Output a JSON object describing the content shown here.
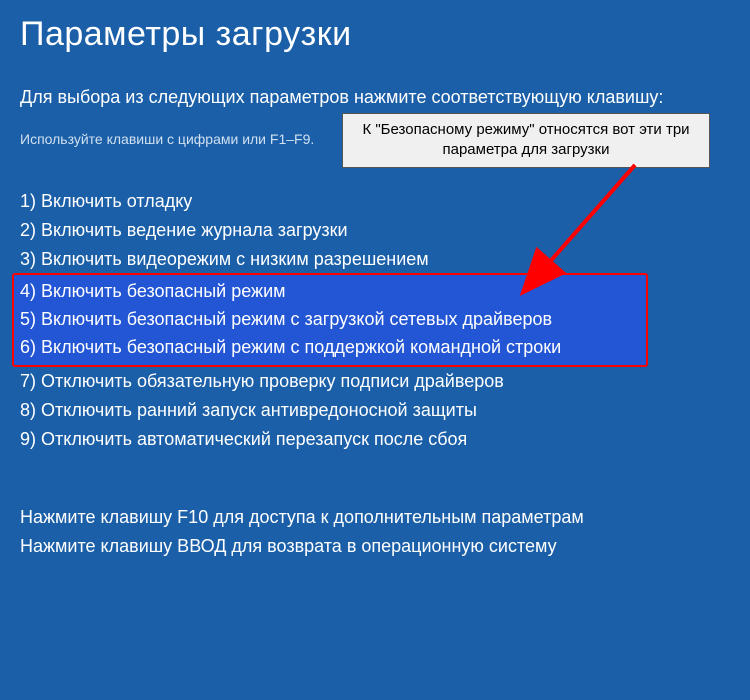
{
  "title": "Параметры загрузки",
  "instruction": "Для выбора из следующих параметров нажмите соответствующую клавишу:",
  "subinstruction": "Используйте клавиши с цифрами или F1–F9.",
  "options": [
    "1) Включить отладку",
    "2) Включить ведение журнала загрузки",
    "3) Включить видеорежим с низким разрешением",
    "4) Включить безопасный режим",
    "5) Включить безопасный режим с загрузкой сетевых драйверов",
    "6) Включить безопасный режим с поддержкой командной строки",
    "7) Отключить обязательную проверку подписи драйверов",
    "8) Отключить ранний запуск антивредоносной защиты",
    "9) Отключить автоматический перезапуск после сбоя"
  ],
  "footer": {
    "f10": "Нажмите клавишу F10 для доступа к дополнительным параметрам",
    "enter": "Нажмите клавишу ВВОД для возврата в операционную систему"
  },
  "annotation": "К \"Безопасному режиму\" относятся вот эти три параметра для загрузки",
  "colors": {
    "background": "#1a5fa8",
    "highlight_bg": "#2256d4",
    "highlight_border": "#ff0000",
    "annotation_bg": "#f0f0f0"
  }
}
